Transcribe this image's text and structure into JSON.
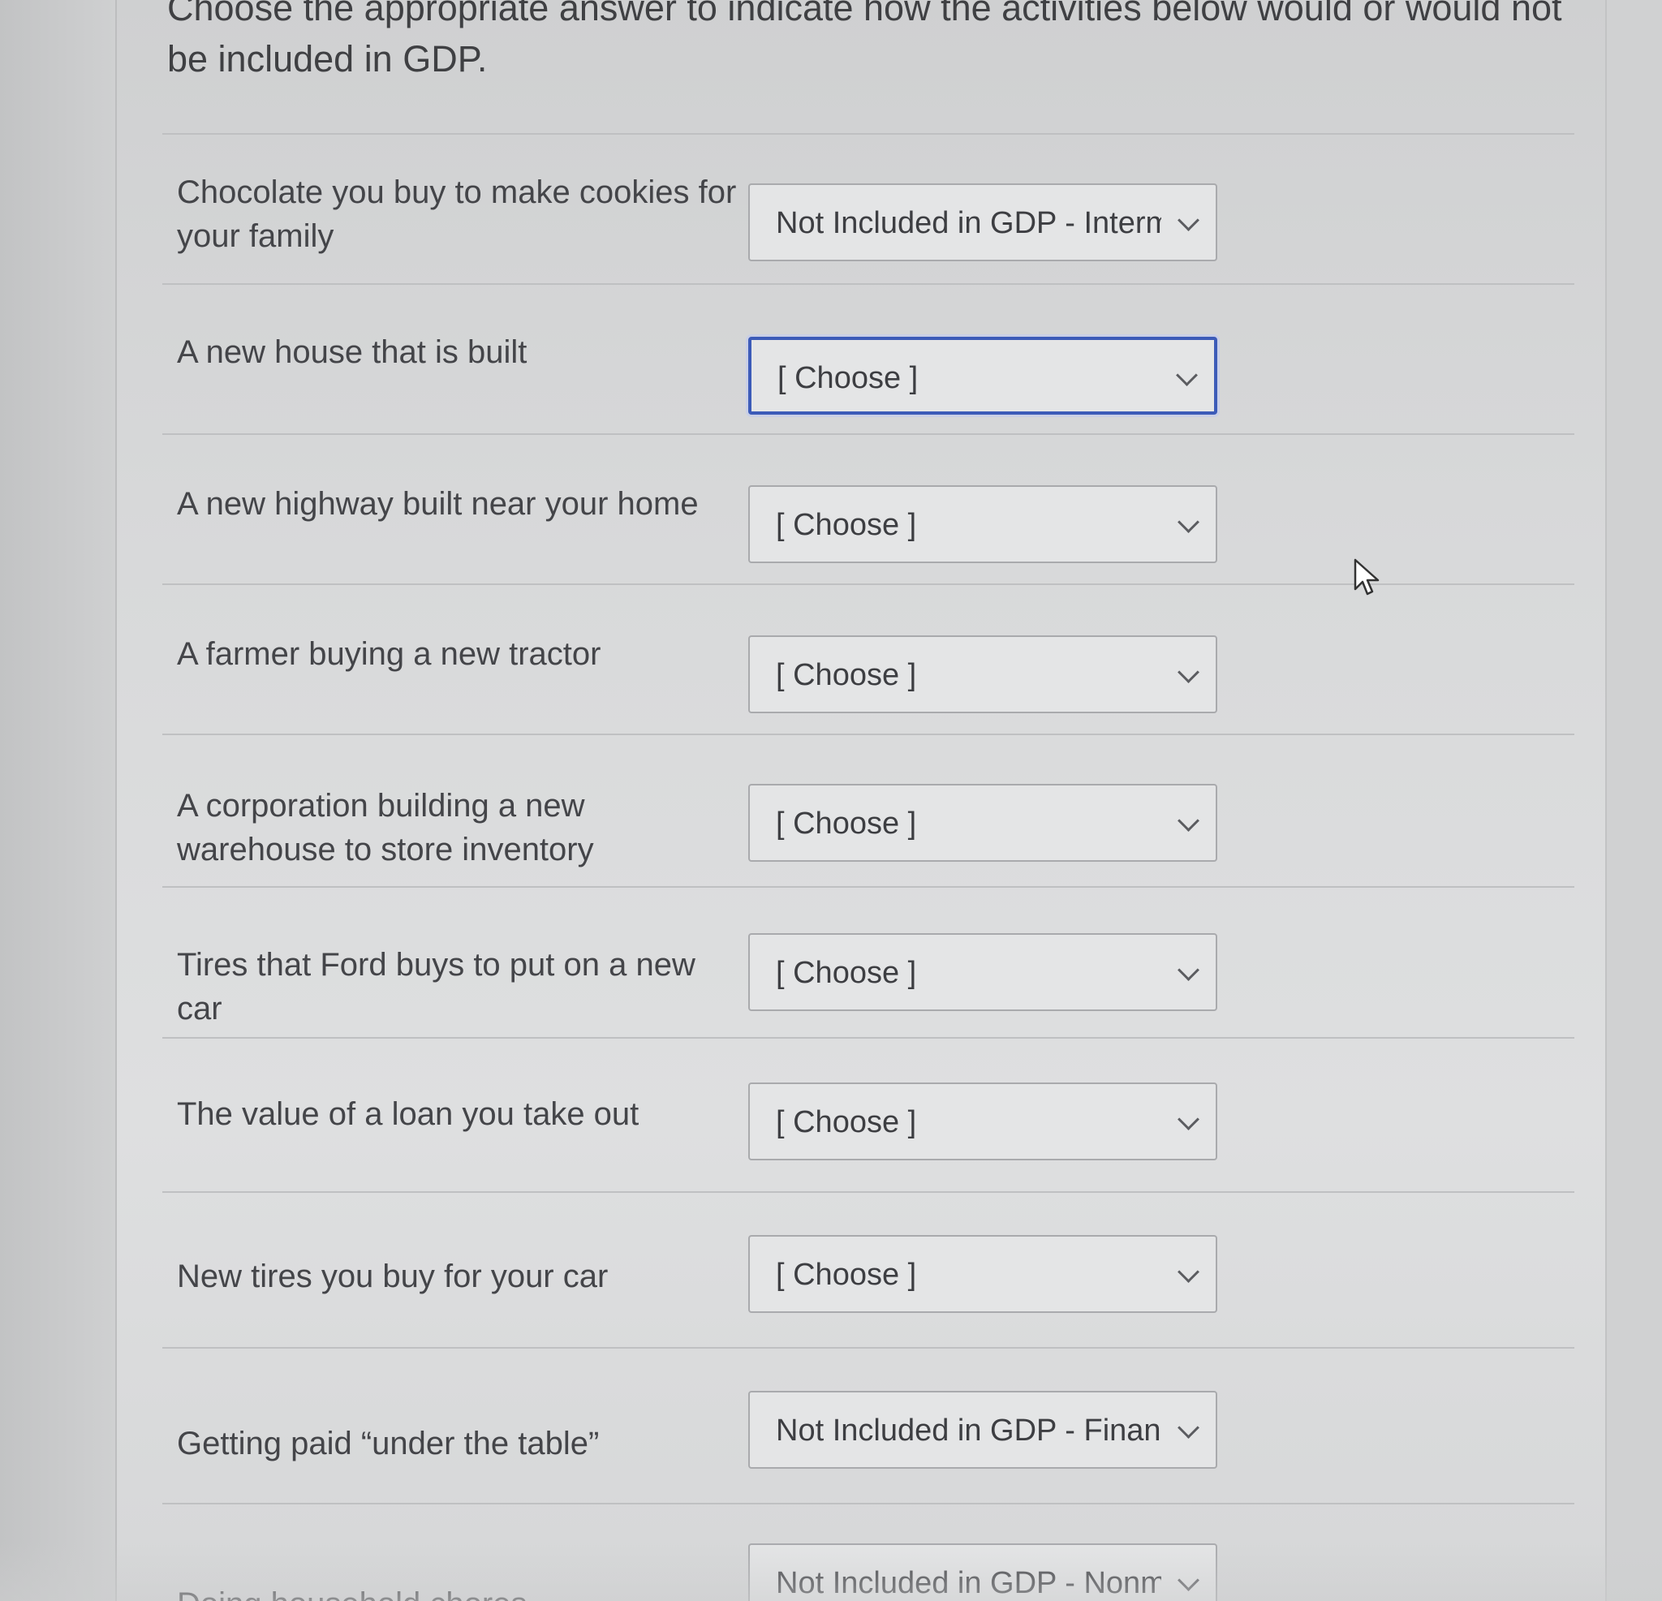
{
  "instructions": "Choose the appropriate answer to indicate how the activities below would or would not be included in GDP.",
  "questions": [
    {
      "label": "Chocolate you buy to make cookies for your family",
      "answer": "Not Included in GDP - Interme"
    },
    {
      "label": "A new house that is built",
      "answer": "[ Choose ]"
    },
    {
      "label": "A new highway built near your home",
      "answer": "[ Choose ]"
    },
    {
      "label": "A farmer buying a new tractor",
      "answer": "[ Choose ]"
    },
    {
      "label": "A corporation building a new warehouse to store inventory",
      "answer": "[ Choose ]"
    },
    {
      "label": "Tires that Ford buys to put on a new car",
      "answer": "[ Choose ]"
    },
    {
      "label": "The value of a loan you take out",
      "answer": "[ Choose ]"
    },
    {
      "label": "New tires you buy for your car",
      "answer": "[ Choose ]"
    },
    {
      "label": "Getting paid “under the table”",
      "answer": "Not Included in GDP - Financi"
    },
    {
      "label": "Doing household chores",
      "answer": "Not Included in GDP - Nonma"
    }
  ],
  "icons": {
    "dropdown": "chevron-down-icon",
    "pointer": "mouse-cursor-icon"
  },
  "colors": {
    "focus_border": "#3c5bb8",
    "text": "#444549"
  }
}
